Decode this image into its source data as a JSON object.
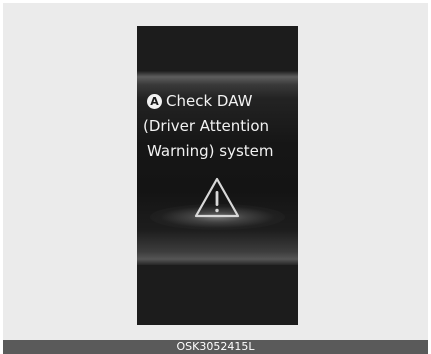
{
  "display": {
    "callout_marker": "A",
    "message_lines": [
      "Check DAW",
      "(Driver Attention",
      "Warning) system"
    ],
    "icon": "warning-triangle-icon"
  },
  "caption": {
    "code": "OSK3052415L"
  },
  "colors": {
    "display_background": "#1c1c1c",
    "text": "#f2f2f2",
    "caption_bar": "#5a5a5a",
    "frame": "#ebebeb"
  }
}
